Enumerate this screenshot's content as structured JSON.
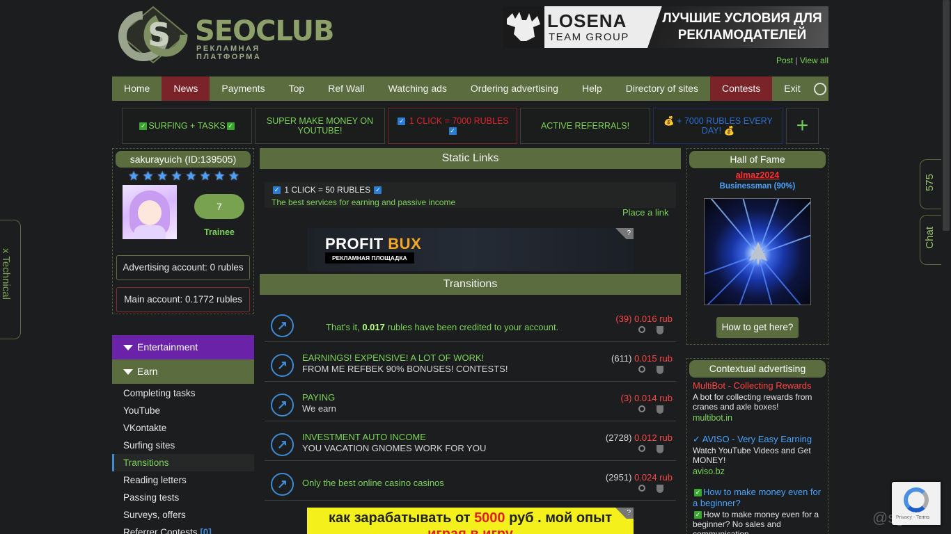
{
  "logo": {
    "text": "SEOCLUB",
    "subtitle": "РЕКЛАМНАЯ ПЛАТФОРМА"
  },
  "top_banner": {
    "brand_line1": "LOSENA",
    "brand_line2": "TEAM GROUP",
    "slogan": "ЛУЧШИЕ УСЛОВИЯ ДЛЯ РЕКЛАМОДАТЕЛЕЙ"
  },
  "post_links": {
    "post": "Post",
    "separator": " | ",
    "view_all": "View all"
  },
  "nav": [
    {
      "label": "Home"
    },
    {
      "label": "News"
    },
    {
      "label": "Payments"
    },
    {
      "label": "Top"
    },
    {
      "label": "Ref Wall"
    },
    {
      "label": "Watching ads"
    },
    {
      "label": "Ordering advertising"
    },
    {
      "label": "Help"
    },
    {
      "label": "Directory of sites"
    },
    {
      "label": "Contests"
    },
    {
      "label": "Exit"
    }
  ],
  "promos": [
    {
      "label": "SURFING + TASKS",
      "color": "#7cd35a"
    },
    {
      "label": "SUPER MAKE MONEY ON YOUTUBE!",
      "color": "#7cd35a"
    },
    {
      "label": "1 CLICK = 7000 RUBLES",
      "color": "#e3202a"
    },
    {
      "label": "ACTIVE REFERRALS!",
      "color": "#7cd35a"
    },
    {
      "label": "+ 7000 RUBLES EVERY DAY!",
      "color": "#2b6fd6"
    }
  ],
  "promo_plus": "+",
  "user": {
    "name": "sakurayuich (ID:139505)",
    "stars": 8,
    "level": "7",
    "rank": "Trainee",
    "advertising_account": "Advertising account: 0 rubles",
    "main_account": "Main account: 0.1772 rubles"
  },
  "menu": {
    "entertainment": "Entertainment",
    "earn": "Earn",
    "items": [
      {
        "label": "Completing tasks"
      },
      {
        "label": "YouTube"
      },
      {
        "label": "VKontakte"
      },
      {
        "label": "Surfing sites"
      },
      {
        "label": "Transitions"
      },
      {
        "label": "Reading letters"
      },
      {
        "label": "Passing tests"
      },
      {
        "label": "Surveys, offers"
      }
    ],
    "referrer_contests": "Referrer Contests",
    "referrer_badge": "[0]"
  },
  "static_links": {
    "header": "Static Links",
    "title": "1 CLICK = 50 RUBLES",
    "description": "The best services for earning and passive income",
    "place_link": "Place a link"
  },
  "profit_banner": {
    "brand": "PROFIT",
    "brand_accent": "BUX",
    "sub": "РЕКЛАМНАЯ ПЛОЩАДКА",
    "q": "?"
  },
  "transitions": {
    "header": "Transitions",
    "rows": [
      {
        "credited_before": "That's it, ",
        "credited_amount": "0.017",
        "credited_after": " rubles have been credited to your account.",
        "count": "(39)",
        "count_red": true,
        "price": "0.016 rub"
      },
      {
        "title": "EARNINGS! EXPENSIVE! A LOT OF WORK!",
        "subtitle": "FROM ME REFBEK 90% BONUSES! CONTESTS!",
        "count": "(611)",
        "count_red": false,
        "price": "0.015 rub"
      },
      {
        "title": "PAYING",
        "subtitle": "We earn",
        "count": "(3)",
        "count_red": true,
        "price": "0.014 rub"
      },
      {
        "title": "INVESTMENT AUTO INCOME",
        "subtitle": "YOU VACATION GNOMES WORK FOR YOU",
        "count": "(2728)",
        "count_red": false,
        "price": "0.012 rub"
      },
      {
        "title": "Only the best online casino casinos",
        "subtitle": "",
        "count": "(2951)",
        "count_red": false,
        "price": "0.024 rub"
      }
    ]
  },
  "yellow_banner": {
    "line1_before": "как зарабатывать от ",
    "line1_amount": "5000",
    "line1_after": " руб . мой опыт",
    "line2": "играя в игру",
    "q": "?"
  },
  "hall_of_fame": {
    "header": "Hall of Fame",
    "name": "almaz2024",
    "role": "Businessman (90%)",
    "button": "How to get here?"
  },
  "contextual": {
    "header": "Contextual advertising",
    "items": [
      {
        "title": "MultiBot - Collecting Rewards",
        "title_color": "#ff4545",
        "desc": "A bot for collecting rewards from cranes and axle boxes!",
        "url": "multibot.in"
      },
      {
        "title": "✓ AVISO - Very Easy Earning",
        "title_color": "#4aa3ff",
        "desc": "Watch YouTube Videos and Get MONEY!",
        "url": "aviso.bz"
      },
      {
        "title": "How to make money even for a beginner?",
        "title_color": "#4aa3ff",
        "desc": "How to make money even for a beginner? No sales and communication",
        "url": ""
      }
    ]
  },
  "side_tabs": {
    "technical": "x Technical",
    "count": "575",
    "chat": "Chat"
  },
  "recaptcha": {
    "text": "Privacy - Terms"
  },
  "watermark": "@sgeii"
}
